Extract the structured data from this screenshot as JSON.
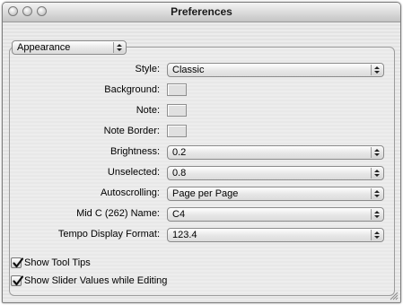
{
  "window": {
    "title": "Preferences"
  },
  "section_popup": {
    "value": "Appearance"
  },
  "fields": [
    {
      "label": "Style:",
      "type": "popup",
      "value": "Classic"
    },
    {
      "label": "Background:",
      "type": "swatch"
    },
    {
      "label": "Note:",
      "type": "swatch"
    },
    {
      "label": "Note Border:",
      "type": "swatch"
    },
    {
      "label": "Brightness:",
      "type": "popup",
      "value": "0.2"
    },
    {
      "label": "Unselected:",
      "type": "popup",
      "value": "0.8"
    },
    {
      "label": "Autoscrolling:",
      "type": "popup",
      "value": "Page per Page"
    },
    {
      "label": "Mid C (262) Name:",
      "type": "popup",
      "value": "C4"
    },
    {
      "label": "Tempo Display Format:",
      "type": "popup",
      "value": "123.4"
    }
  ],
  "checkboxes": [
    {
      "label": "Show Tool Tips",
      "checked": true
    },
    {
      "label": "Show Slider Values while Editing",
      "checked": true
    }
  ],
  "icons": {
    "close": "close-icon",
    "minimize": "minimize-icon",
    "zoom": "zoom-icon",
    "popup_arrows": "up-down-arrows-icon",
    "checkmark": "checkmark-icon",
    "resize": "resize-grip-icon"
  }
}
